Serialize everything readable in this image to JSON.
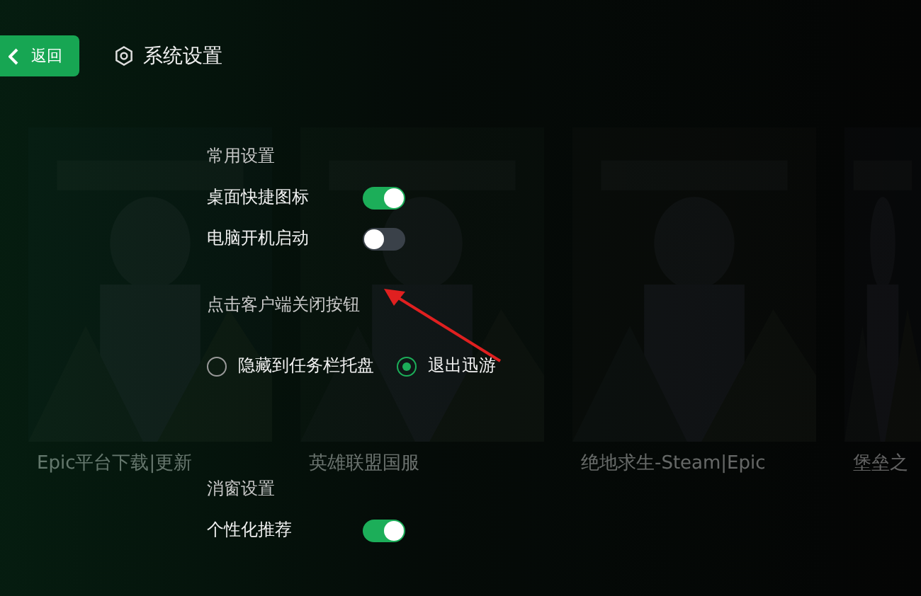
{
  "header": {
    "back_label": "返回",
    "title": "系统设置"
  },
  "background_games": [
    {
      "title": "Epic平台下载|更新"
    },
    {
      "title": "英雄联盟国服"
    },
    {
      "title": "绝地求生-Steam|Epic"
    },
    {
      "title": "堡垒之"
    }
  ],
  "sections": [
    {
      "title": "常用设置",
      "rows": [
        {
          "kind": "toggle",
          "label": "桌面快捷图标",
          "on": true
        },
        {
          "kind": "toggle",
          "label": "电脑开机启动",
          "on": false
        }
      ]
    },
    {
      "title": "点击客户端关闭按钮",
      "rows": [
        {
          "kind": "radios",
          "options": [
            {
              "label": "隐藏到任务栏托盘",
              "selected": false
            },
            {
              "label": "退出迅游",
              "selected": true
            }
          ]
        }
      ]
    },
    {
      "title": "消窗设置",
      "rows": [
        {
          "kind": "toggle",
          "label": "个性化推荐",
          "on": true
        }
      ]
    }
  ]
}
